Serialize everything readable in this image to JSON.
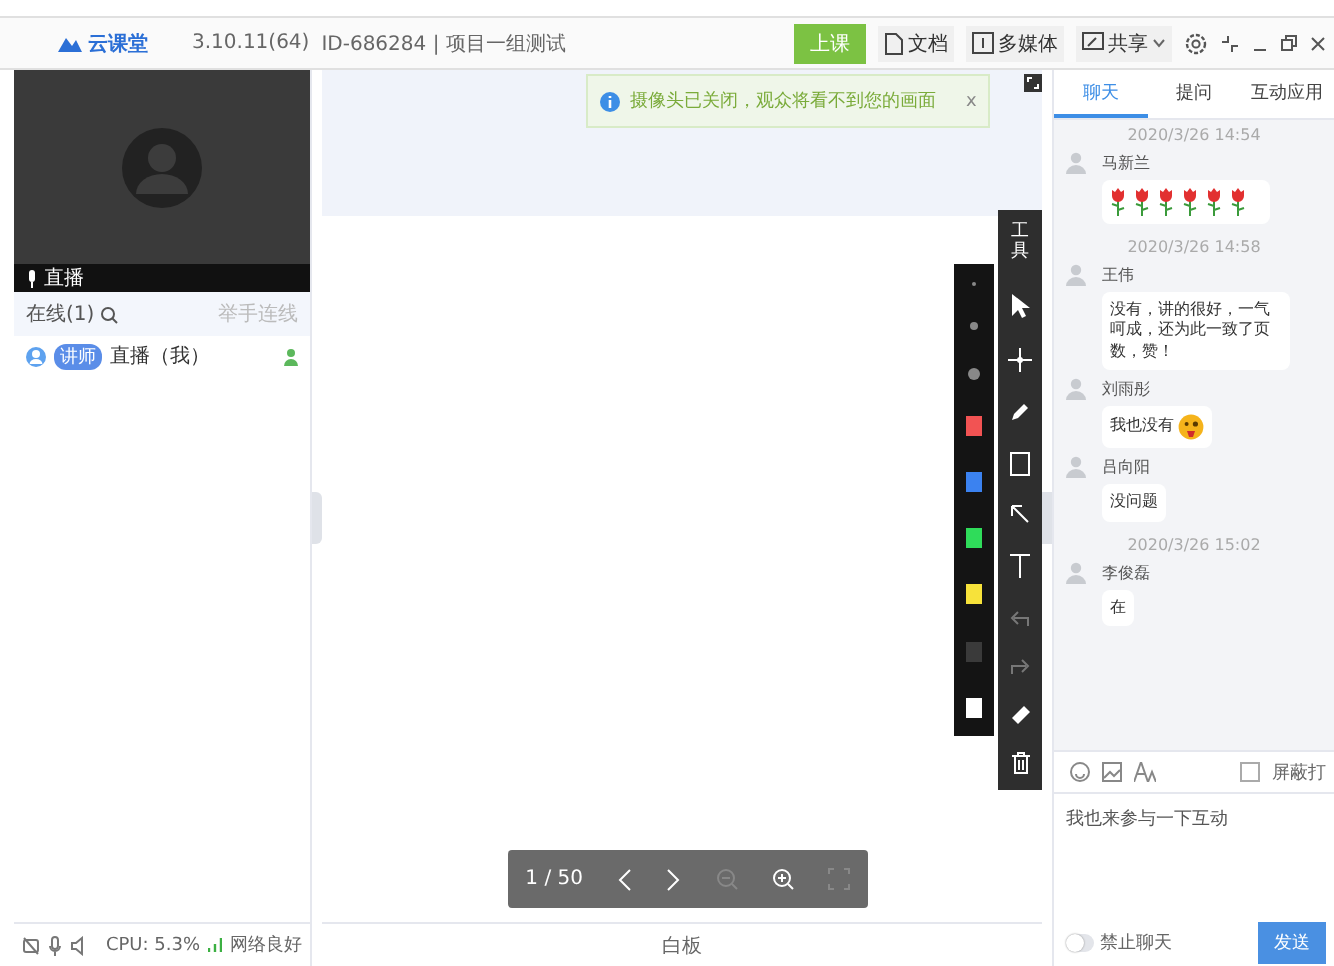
{
  "header": {
    "logo": "云课堂",
    "version": "3.10.11(64)",
    "room": "ID-686284 | 项目一组测试",
    "start_button": "上课",
    "tools": [
      {
        "kind": "doc",
        "label": "文档"
      },
      {
        "kind": "media",
        "label": "多媒体"
      },
      {
        "kind": "share",
        "label": "共享"
      }
    ]
  },
  "left": {
    "video_label": "直播",
    "online": "在线(1)",
    "raise_hand": "举手连线",
    "users": [
      {
        "badge": "讲师",
        "name": "直播（我）"
      }
    ],
    "cpu": "CPU: 5.3%",
    "network": "网络良好"
  },
  "notice": {
    "text": "摄像头已关闭，观众将看不到您的画面",
    "close": "x"
  },
  "whiteboard": {
    "label": "白板",
    "page": "1 / 50",
    "tools_label": "工具",
    "colors": [
      {
        "color": "#f25353"
      },
      {
        "color": "#3b82f0"
      },
      {
        "color": "#2fdc5a"
      },
      {
        "color": "#f7e23a"
      },
      {
        "color": "#3a3a3a"
      },
      {
        "color": "#ffffff"
      }
    ]
  },
  "chat": {
    "tabs": [
      {
        "label": "聊天",
        "selected": true
      },
      {
        "label": "提问",
        "selected": false
      },
      {
        "label": "互动应用",
        "selected": false
      }
    ],
    "messages": [
      {
        "kind": "time",
        "text": "2020/3/26 14:54"
      },
      {
        "kind": "roses",
        "name": "马新兰"
      },
      {
        "kind": "time",
        "text": "2020/3/26 14:58"
      },
      {
        "kind": "text",
        "name": "王伟",
        "text": "没有，讲的很好，一气呵成，还为此一致了页数，赞！"
      },
      {
        "kind": "emoji",
        "name": "刘雨彤",
        "text": "我也没有"
      },
      {
        "kind": "text",
        "name": "吕向阳",
        "text": "没问题"
      },
      {
        "kind": "time",
        "text": "2020/3/26 15:02"
      },
      {
        "kind": "text",
        "name": "李俊磊",
        "text": "在"
      }
    ],
    "block_gifts": {
      "label": "屏蔽打",
      "checked": false
    },
    "input": "我也来参与一下互动",
    "mute_all": {
      "label": "禁止聊天",
      "on": false
    },
    "send": "发送"
  }
}
